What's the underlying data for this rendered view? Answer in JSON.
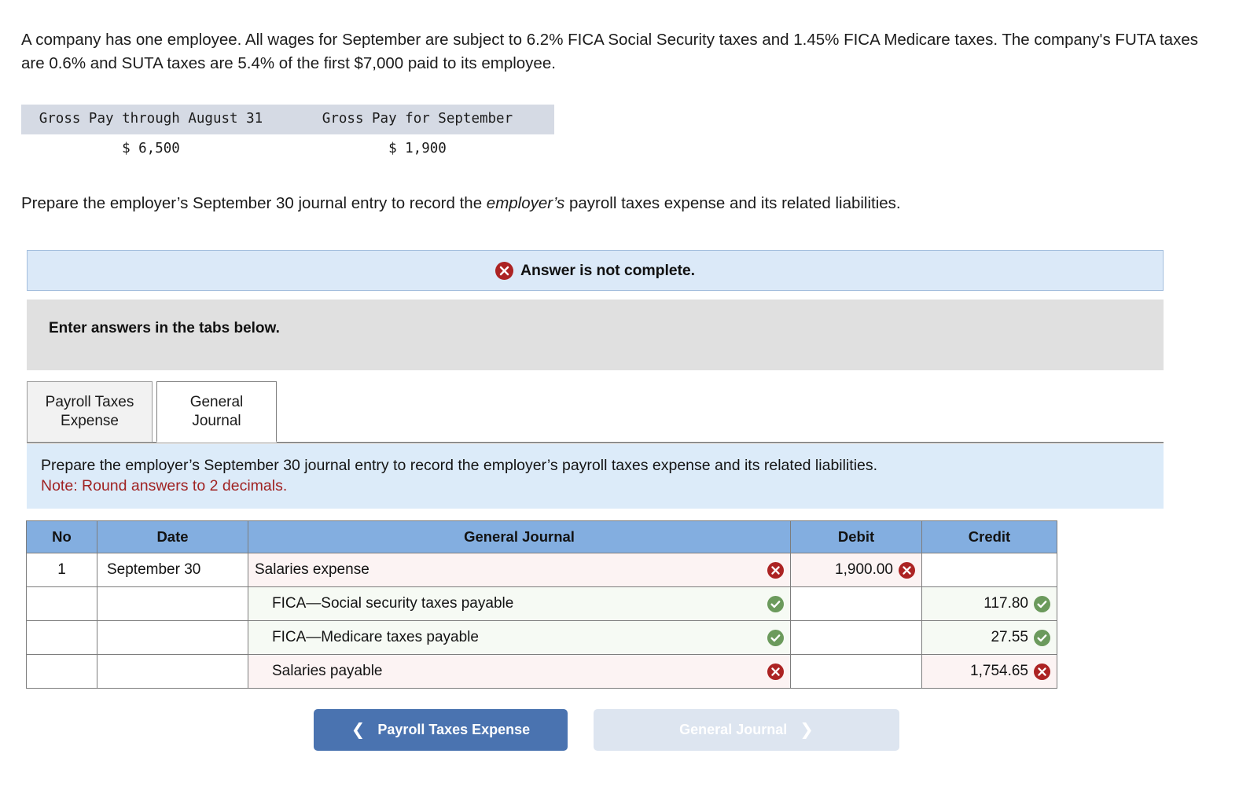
{
  "problem": {
    "statement": "A company has one employee. All wages for September are subject to 6.2% FICA Social Security taxes and 1.45% FICA Medicare taxes. The company's FUTA taxes are 0.6% and SUTA taxes are 5.4% of the first $7,000 paid to its employee.",
    "prepare_prefix": "Prepare the employer’s September 30 journal entry to record the ",
    "prepare_emphasis": "employer’s",
    "prepare_suffix": " payroll taxes expense and its related liabilities."
  },
  "gross_pay_table": {
    "headers": [
      "Gross Pay through August 31",
      "Gross Pay for September"
    ],
    "values": [
      "$ 6,500",
      "$ 1,900"
    ]
  },
  "answer_banner": {
    "icon": "x-circle-icon",
    "label": "Answer is not complete."
  },
  "enter_answers": {
    "label": "Enter answers in the tabs below."
  },
  "tabs": [
    {
      "label_line1": "Payroll Taxes",
      "label_line2": "Expense",
      "active": false
    },
    {
      "label_line1": "General",
      "label_line2": "Journal",
      "active": true
    }
  ],
  "instruction": {
    "main": "Prepare the employer’s September 30 journal entry to record the employer’s payroll taxes expense and its related liabilities.",
    "note": "Note: Round answers to 2 decimals."
  },
  "journal": {
    "columns": [
      "No",
      "Date",
      "General Journal",
      "Debit",
      "Credit"
    ],
    "rows": [
      {
        "no": "1",
        "date": "September 30",
        "account": "Salaries expense",
        "indent": false,
        "account_status": "x",
        "debit": "1,900.00",
        "debit_status": "x",
        "credit": "",
        "credit_status": "",
        "row_state": "wrong"
      },
      {
        "no": "",
        "date": "",
        "account": "FICA—Social security taxes payable",
        "indent": true,
        "account_status": "ok",
        "debit": "",
        "debit_status": "",
        "credit": "117.80",
        "credit_status": "ok",
        "row_state": "right"
      },
      {
        "no": "",
        "date": "",
        "account": "FICA—Medicare taxes payable",
        "indent": true,
        "account_status": "ok",
        "debit": "",
        "debit_status": "",
        "credit": "27.55",
        "credit_status": "ok",
        "row_state": "right"
      },
      {
        "no": "",
        "date": "",
        "account": "Salaries payable",
        "indent": true,
        "account_status": "x",
        "debit": "",
        "debit_status": "",
        "credit": "1,754.65",
        "credit_status": "x",
        "row_state": "wrong"
      }
    ]
  },
  "nav": {
    "prev_label": "Payroll Taxes Expense",
    "prev_icon": "chevron-left-icon",
    "next_label": "General Journal",
    "next_icon": "chevron-right-icon"
  },
  "colors": {
    "header_blue": "#83aee0",
    "banner_blue": "#dbe9f8",
    "instruction_blue": "#dcebf9",
    "gray_box": "#e0e0e0",
    "error_red": "#ac2323",
    "success_green": "#6b9a5c",
    "note_red": "#a02323",
    "primary_button": "#4a73b0",
    "disabled_button": "#dde5f0",
    "gross_header_gray": "#d5dae4"
  }
}
